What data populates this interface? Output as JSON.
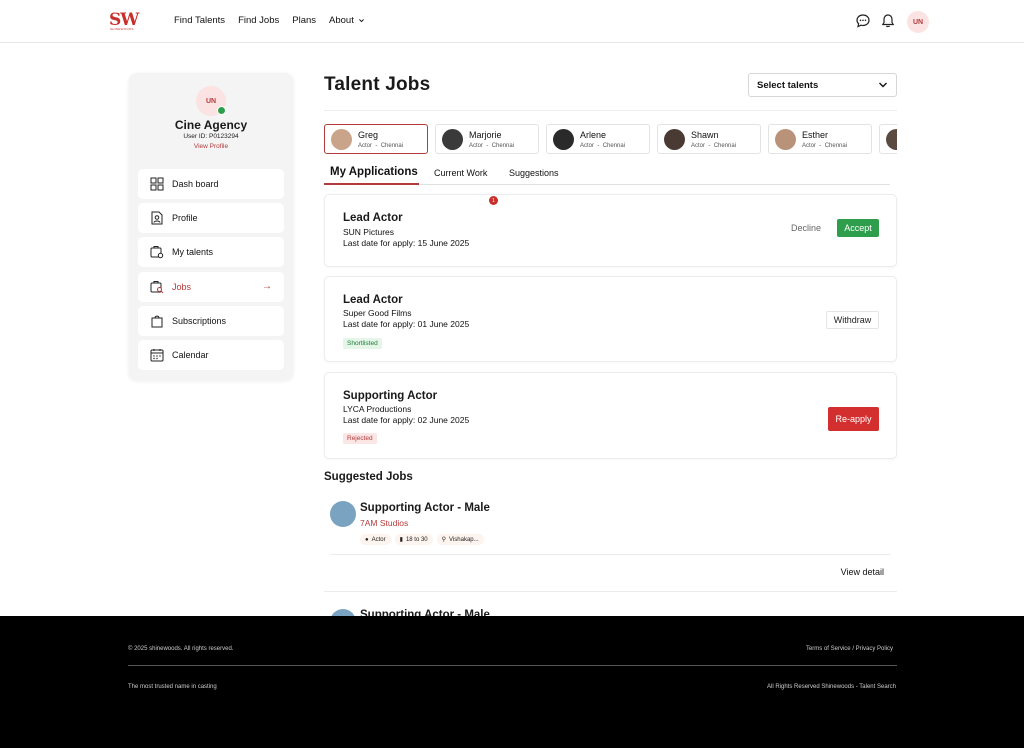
{
  "header": {
    "logo_text": "SW",
    "logo_subtext": "SHINEWOODS",
    "nav": [
      "Find Talents",
      "Find Jobs",
      "Plans",
      "About"
    ],
    "avatar_initials": "UN"
  },
  "sidebar": {
    "avatar_initials": "UN",
    "name": "Cine Agency",
    "user_id": "User ID: P0123294",
    "view_profile": "View Profile",
    "items": [
      {
        "label": "Dash board",
        "icon": "dashboard-icon"
      },
      {
        "label": "Profile",
        "icon": "profile-icon"
      },
      {
        "label": "My talents",
        "icon": "talents-icon"
      },
      {
        "label": "Jobs",
        "icon": "jobs-icon"
      },
      {
        "label": "Subscriptions",
        "icon": "subscriptions-icon"
      },
      {
        "label": "Calendar",
        "icon": "calendar-icon"
      }
    ],
    "active_item": "Jobs"
  },
  "main": {
    "title": "Talent Jobs",
    "select_placeholder": "Select talents",
    "talents": [
      {
        "name": "Greg",
        "role": "Actor",
        "location": "Chennai"
      },
      {
        "name": "Marjorie",
        "role": "Actor",
        "location": "Chennai"
      },
      {
        "name": "Arlene",
        "role": "Actor",
        "location": "Chennai"
      },
      {
        "name": "Shawn",
        "role": "Actor",
        "location": "Chennai"
      },
      {
        "name": "Esther",
        "role": "Actor",
        "location": "Chennai"
      }
    ],
    "tabs": [
      "My Applications",
      "Current Work",
      "Suggestions"
    ],
    "notification_count": "1",
    "applications": [
      {
        "title": "Lead Actor",
        "company": "SUN Pictures",
        "date": "Last date for apply: 15 June 2025",
        "decline": "Decline",
        "accept": "Accept"
      },
      {
        "title": "Lead Actor",
        "company": "Super Good Films",
        "date": "Last date for apply: 01 June 2025",
        "status": "Shortlisted",
        "action": "Withdraw"
      },
      {
        "title": "Supporting Actor",
        "company": "LYCA Productions",
        "date": "Last date for apply: 02 June 2025",
        "status": "Rejected",
        "action": "Re-apply"
      }
    ],
    "suggested_heading": "Suggested Jobs",
    "suggested": [
      {
        "title": "Supporting Actor - Male",
        "studio": "7AM Studios",
        "chips": [
          "Actor",
          "18 to 30",
          "Vishakap..."
        ],
        "view": "View detail"
      },
      {
        "title": "Supporting Actor - Male"
      }
    ]
  },
  "footer": {
    "copyright": "© 2025 shinewoods. All rights reserved.",
    "terms": "Terms of Service / Privacy Policy",
    "tagline": "The most trusted name in casting",
    "rights": "All Rights Reserved Shinewoods - Talent Search"
  },
  "colors": {
    "accent": "#b23b3b",
    "success": "#2e9e4c",
    "danger": "#d32f2f",
    "footer_bg": "#000000"
  }
}
